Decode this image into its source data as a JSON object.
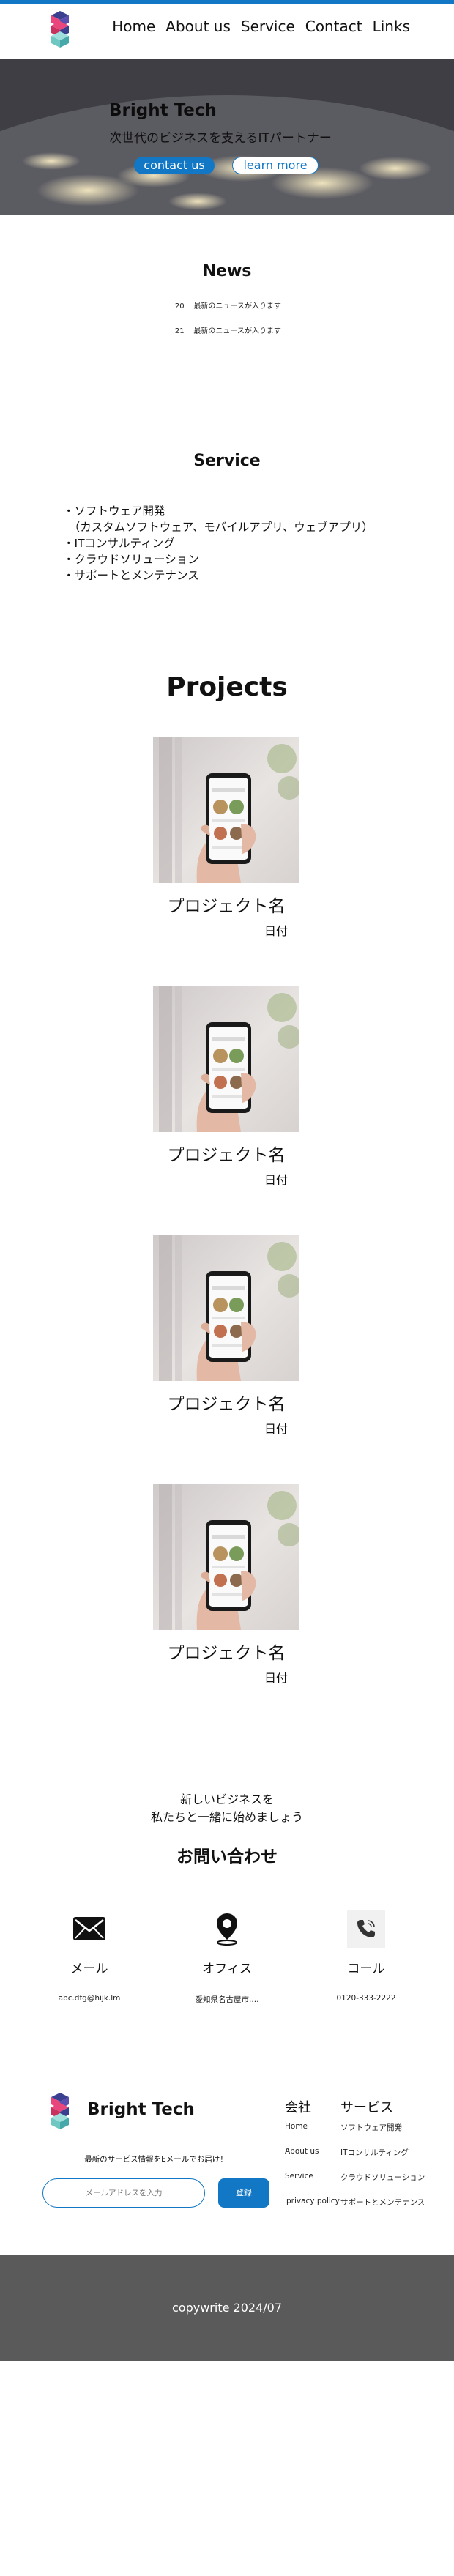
{
  "nav": {
    "items": [
      {
        "label": "Home"
      },
      {
        "label": "About us"
      },
      {
        "label": "Service"
      },
      {
        "label": "Contact"
      },
      {
        "label": "Links"
      }
    ]
  },
  "hero": {
    "title": "Bright Tech",
    "subtitle": "次世代のビジネスを支えるITパートナー",
    "contact_label": "contact us",
    "learn_label": "learn more"
  },
  "news": {
    "title": "News",
    "items": [
      {
        "year": "'20",
        "text": "最新のニュースが入ります"
      },
      {
        "year": "'21",
        "text": "最新のニュースが入ります"
      }
    ]
  },
  "service": {
    "title": "Service",
    "items": [
      "・ソフトウェア開発",
      "　（カスタムソフトウェア、モバイルアプリ、ウェブアプリ）",
      "・ITコンサルティング",
      "・クラウドソリューション",
      "・サポートとメンテナンス"
    ]
  },
  "projects": {
    "title": "Projects",
    "items": [
      {
        "name": "プロジェクト名",
        "date": "日付"
      },
      {
        "name": "プロジェクト名",
        "date": "日付"
      },
      {
        "name": "プロジェクト名",
        "date": "日付"
      },
      {
        "name": "プロジェクト名",
        "date": "日付"
      }
    ]
  },
  "cta": {
    "line1": "新しいビジネスを",
    "line2": "私たちと一緒に始めましょう",
    "title": "お問い合わせ"
  },
  "contact": {
    "items": [
      {
        "label": "メール",
        "value": "abc.dfg@hijk.lm",
        "icon": "mail-icon"
      },
      {
        "label": "オフィス",
        "value": "愛知県名古屋市....",
        "icon": "location-pin-icon"
      },
      {
        "label": "コール",
        "value": "0120-333-2222",
        "icon": "phone-icon"
      }
    ]
  },
  "footer": {
    "brand": "Bright Tech",
    "newsletter_text": "最新のサービス情報をEメールでお届け！",
    "email_placeholder": "メールアドレスを入力",
    "subscribe_label": "登録",
    "company_title": "会社",
    "company_links": [
      "Home",
      "About us",
      "Service",
      "privacy policy"
    ],
    "service_title": "サービス",
    "service_links": [
      "ソフトウェア開発",
      "ITコンサルティング",
      "クラウドソリューション",
      "サポートとメンテナンス"
    ],
    "copyright": "copywrite 2024/07"
  },
  "colors": {
    "accent": "#1277c4",
    "footer_bg": "#5a5a5a"
  }
}
